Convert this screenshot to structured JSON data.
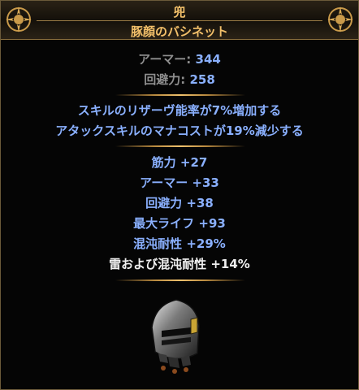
{
  "item": {
    "type": "兜",
    "name": "豚顔のバシネット",
    "armour_label": "アーマー:",
    "armour_value": "344",
    "evasion_label": "回避力:",
    "evasion_value": "258"
  },
  "implicit_mods": [
    "スキルのリザーヴ能率が7%増加する",
    "アタックスキルのマナコストが19%減少する"
  ],
  "explicit_mods": [
    "筋力 +27",
    "アーマー +33",
    "回避力 +38",
    "最大ライフ +93",
    "混沌耐性 +29%",
    "雷および混沌耐性 +14%"
  ],
  "colors": {
    "title": "#f3c06a",
    "magic_blue": "#8ab0ff",
    "label_gray": "#8f8f8f"
  },
  "icons": [
    "ornament-left-icon",
    "ornament-right-icon",
    "helmet-item-icon"
  ]
}
